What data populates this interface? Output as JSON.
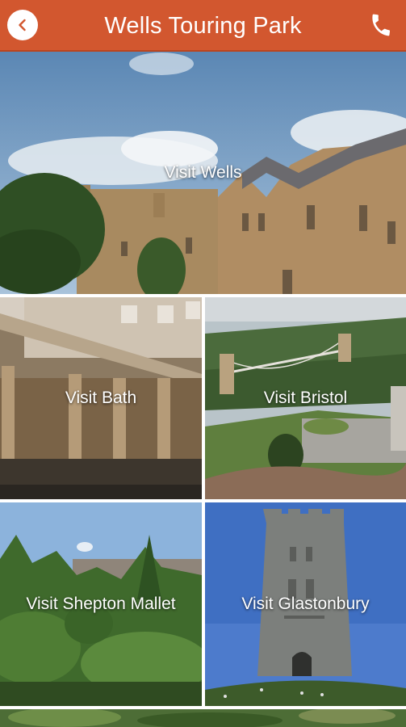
{
  "header": {
    "title": "Wells Touring Park",
    "back_icon": "chevron-left-icon",
    "phone_icon": "phone-icon",
    "background_color": "#d2572f"
  },
  "tiles": [
    {
      "label": "Visit Wells"
    },
    {
      "label": "Visit Bath"
    },
    {
      "label": "Visit Bristol"
    },
    {
      "label": "Visit Shepton Mallet"
    },
    {
      "label": "Visit Glastonbury"
    }
  ]
}
